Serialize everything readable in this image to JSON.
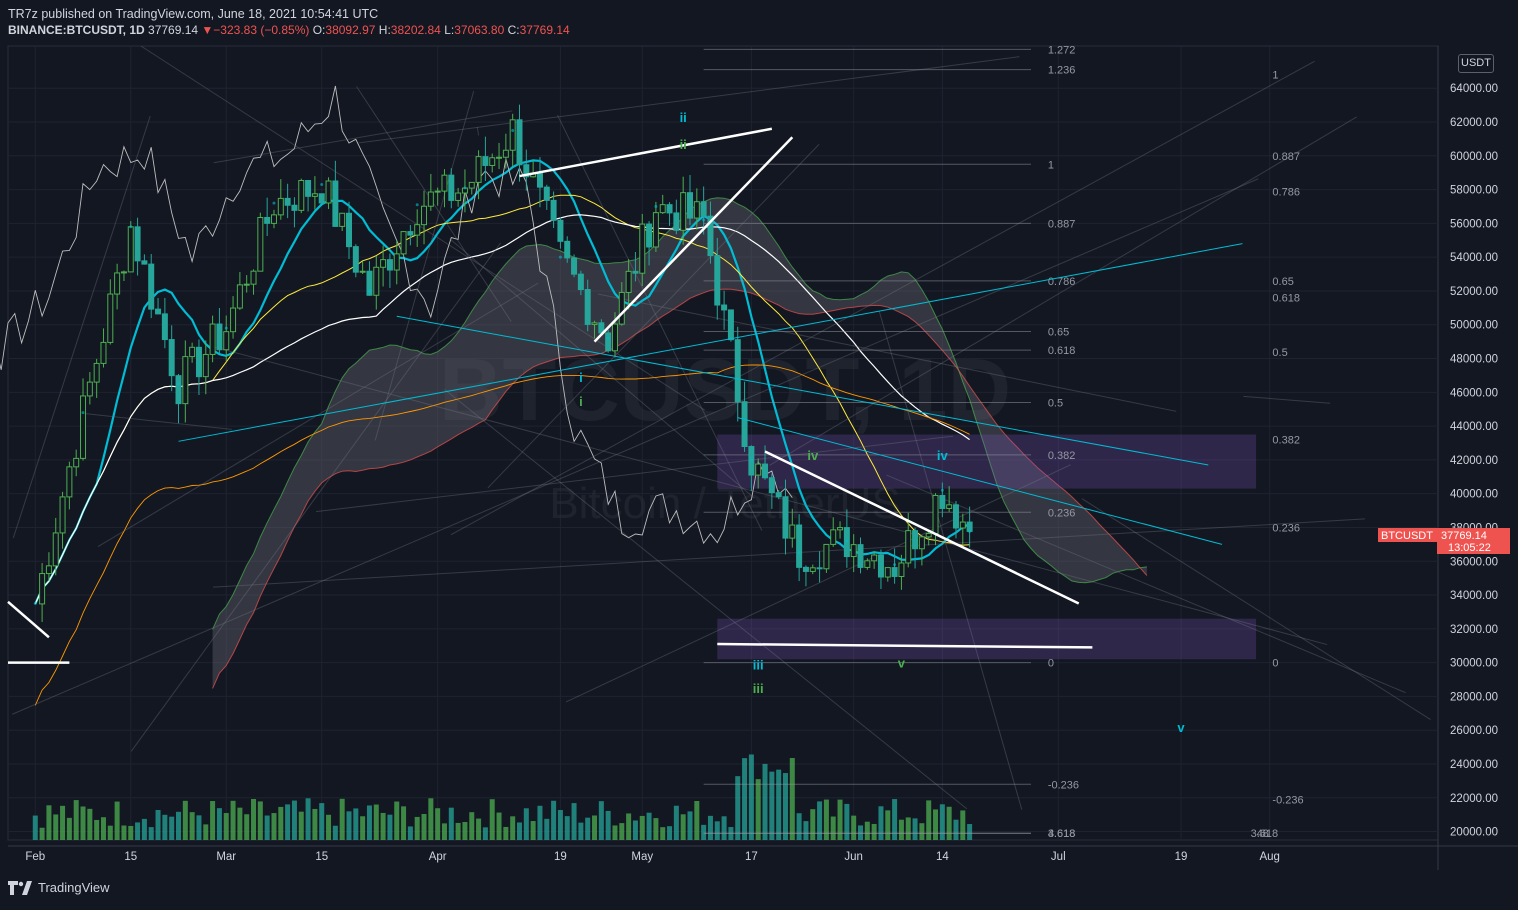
{
  "header": {
    "line1": "TR7z published on TradingView.com, June 18, 2021 10:54:41 UTC",
    "symbol": "BINANCE:BTCUSDT, 1D",
    "last": "37769.14",
    "change": "▼−323.83 (−0.85%)",
    "o_label": "O:",
    "o": "38092.97",
    "h_label": "H:",
    "h": "38202.84",
    "l_label": "L:",
    "l": "37063.80",
    "c_label": "C:",
    "c": "37769.14"
  },
  "watermark": {
    "big": "BTCUSDT, 1D",
    "small": "Bitcoin / TetherUS"
  },
  "currency_badge": "USDT",
  "price_tag": {
    "symbol": "BTCUSDT",
    "price": "37769.14",
    "countdown": "13:05:22"
  },
  "footer": {
    "brand": "TradingView"
  },
  "colors": {
    "bg": "#131722",
    "up": "#4caf50",
    "down": "#26a69a",
    "cyan": "#00bcd4",
    "red": "#ef5350"
  },
  "chart_data": {
    "type": "line",
    "title": "",
    "xlabel": "",
    "ylabel": "",
    "x_ticks": [
      "Feb",
      "15",
      "Mar",
      "15",
      "Apr",
      "19",
      "May",
      "17",
      "Jun",
      "14",
      "Jul",
      "19",
      "Aug"
    ],
    "y_ticks": [
      "20000.00",
      "22000.00",
      "24000.00",
      "26000.00",
      "28000.00",
      "30000.00",
      "32000.00",
      "34000.00",
      "36000.00",
      "38000.00",
      "40000.00",
      "42000.00",
      "44000.00",
      "46000.00",
      "48000.00",
      "50000.00",
      "52000.00",
      "54000.00",
      "56000.00",
      "58000.00",
      "60000.00",
      "62000.00",
      "64000.00"
    ],
    "ylim": [
      19500,
      66500
    ],
    "grid": true,
    "series": [
      {
        "x": [
          "2021-02-01",
          "2021-02-08",
          "2021-02-15",
          "2021-02-22",
          "2021-03-01",
          "2021-03-08",
          "2021-03-15",
          "2021-03-22",
          "2021-03-29",
          "2021-04-05",
          "2021-04-12",
          "2021-04-19",
          "2021-04-26",
          "2021-05-03",
          "2021-05-10",
          "2021-05-17",
          "2021-05-24",
          "2021-05-31",
          "2021-06-07",
          "2021-06-14",
          "2021-06-18"
        ],
        "values": [
          33500,
          44800,
          55800,
          46500,
          49800,
          57200,
          58300,
          52000,
          57100,
          58100,
          61500,
          54000,
          49200,
          57000,
          56200,
          42000,
          36500,
          37200,
          35800,
          40200,
          37769
        ]
      }
    ],
    "fib_labels_left": [
      "1.272",
      "1.236",
      "1",
      "0.887",
      "0.786",
      "0.65",
      "0.618",
      "0.5",
      "0.382",
      "0.236",
      "0",
      "-0.236",
      "3.618",
      "4.618"
    ],
    "fib_labels_right": [
      "1",
      "0.887",
      "0.786",
      "0.65",
      "0.618",
      "0.5",
      "0.382",
      "0.236",
      "0",
      "-0.236",
      "3.618",
      "4",
      "8"
    ],
    "wave_labels": [
      "ii",
      "ii",
      "i",
      "i",
      "iii",
      "iii",
      "iv",
      "iv",
      "v",
      "v"
    ]
  }
}
